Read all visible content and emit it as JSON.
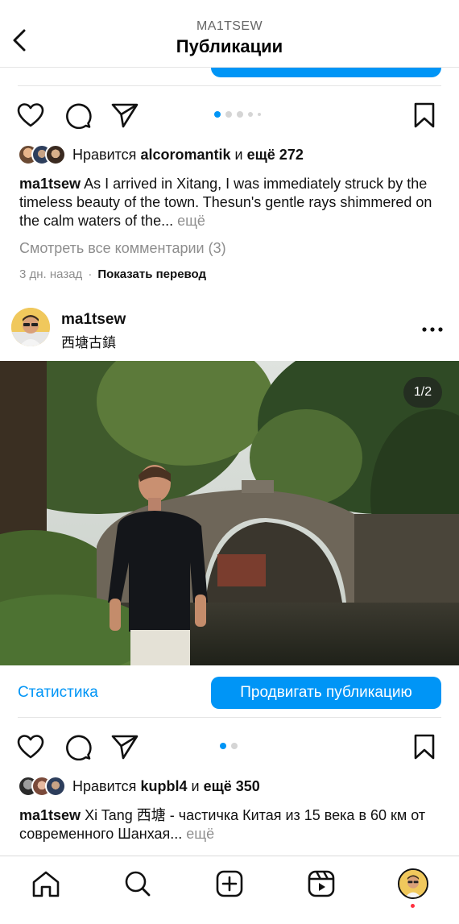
{
  "header": {
    "username": "MA1TSEW",
    "title": "Публикации"
  },
  "post1": {
    "likes_prefix": "Нравится",
    "likes_user": "alcoromantik",
    "likes_and": "и",
    "likes_more": "ещё 272",
    "caption_user": "ma1tsew",
    "caption_text": "As I arrived in Xitang, I was immediately struck by the timeless beauty of the town. Thesun's gentle rays shimmered on the calm waters of the...",
    "caption_more": "ещё",
    "view_comments": "Смотреть все комментарии (3)",
    "time_ago": "3 дн. назад",
    "separator": "·",
    "translate": "Показать перевод",
    "carousel_dots": 5,
    "active_dot": 0
  },
  "post2": {
    "username": "ma1tsew",
    "location": "西塘古鎮",
    "image_counter": "1/2",
    "stats_label": "Статистика",
    "promote_label": "Продвигать публикацию",
    "likes_prefix": "Нравится",
    "likes_user": "kupbl4",
    "likes_and": "и",
    "likes_more": "ещё 350",
    "caption_user": "ma1tsew",
    "caption_text": "Xi Tang 西塘 - частичка Китая из 15 века в 60 км от современного Шанхая...",
    "caption_more": "ещё",
    "carousel_dots": 2,
    "active_dot": 0
  },
  "tabbar": {
    "items": [
      "home-icon",
      "search-icon",
      "create-icon",
      "reels-icon",
      "profile-avatar"
    ],
    "has_notification": true
  },
  "colors": {
    "accent": "#0095f6",
    "notification": "#ff3040",
    "muted_text": "#8e8e8e"
  }
}
